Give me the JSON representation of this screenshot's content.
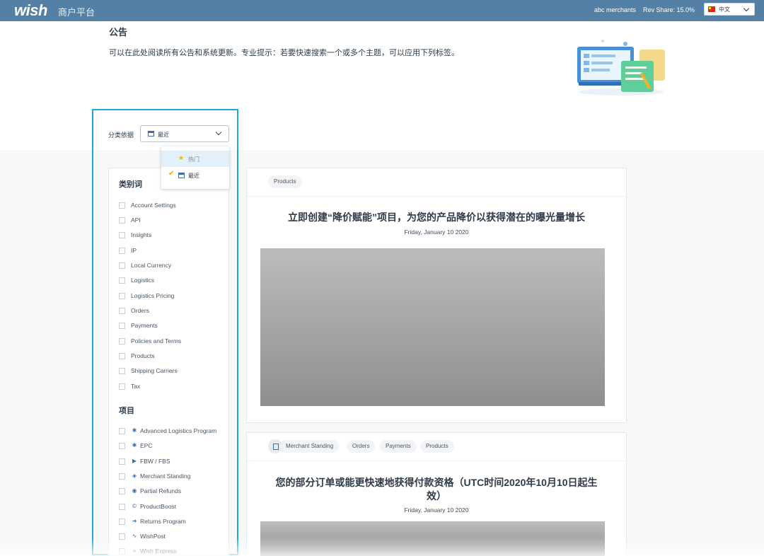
{
  "header": {
    "logo": "wish",
    "platform": "商户平台",
    "merchant": "abc merchants",
    "rev_share": "Rev Share: 15.0%",
    "language": "中文"
  },
  "page": {
    "title": "公告",
    "description": "可以在此处阅读所有公告和系统更新。专业提示：若要快速搜索一个或多个主题，可以应用下列标签。"
  },
  "filter": {
    "sort_label": "分类依据",
    "sort_value": "最近",
    "sort_options": [
      {
        "label": "热门",
        "state": "hover"
      },
      {
        "label": "最近",
        "state": "selected"
      }
    ],
    "category_title": "类别词",
    "categories": [
      "Account Settings",
      "API",
      "Insights",
      "IP",
      "Local Currency",
      "Logistics",
      "Logistics Pricing",
      "Orders",
      "Payments",
      "Policies and Terms",
      "Products",
      "Shipping Carriers",
      "Tax"
    ],
    "program_title": "项目",
    "programs": [
      {
        "label": "Advanced Logistics Program",
        "icon": "gear-icon"
      },
      {
        "label": "EPC",
        "icon": "gear-icon"
      },
      {
        "label": "FBW / FBS",
        "icon": "truck-icon"
      },
      {
        "label": "Merchant Standing",
        "icon": "shield-icon"
      },
      {
        "label": "Partial Refunds",
        "icon": "refund-icon"
      },
      {
        "label": "ProductBoost",
        "icon": "boost-icon"
      },
      {
        "label": "Returns Program",
        "icon": "return-icon"
      },
      {
        "label": "WishPost",
        "icon": "wave-icon"
      },
      {
        "label": "Wish Express",
        "icon": "express-icon"
      }
    ]
  },
  "feed": [
    {
      "tags": [
        "Products"
      ],
      "title": "立即创建“降价赋能”项目，为您的产品降价以获得潜在的曝光量增长",
      "date": "Friday, January 10 2020"
    },
    {
      "tags": [
        "Merchant Standing",
        "Orders",
        "Payments",
        "Products"
      ],
      "title": "您的部分订单或能更快速地获得付款资格（UTC时间2020年10月10日起生效）",
      "date": "Friday, January 10 2020"
    }
  ],
  "colors": {
    "header_bg": "#5580a5",
    "highlight_border": "#1ea7d9",
    "accent": "#3c6fa7"
  }
}
